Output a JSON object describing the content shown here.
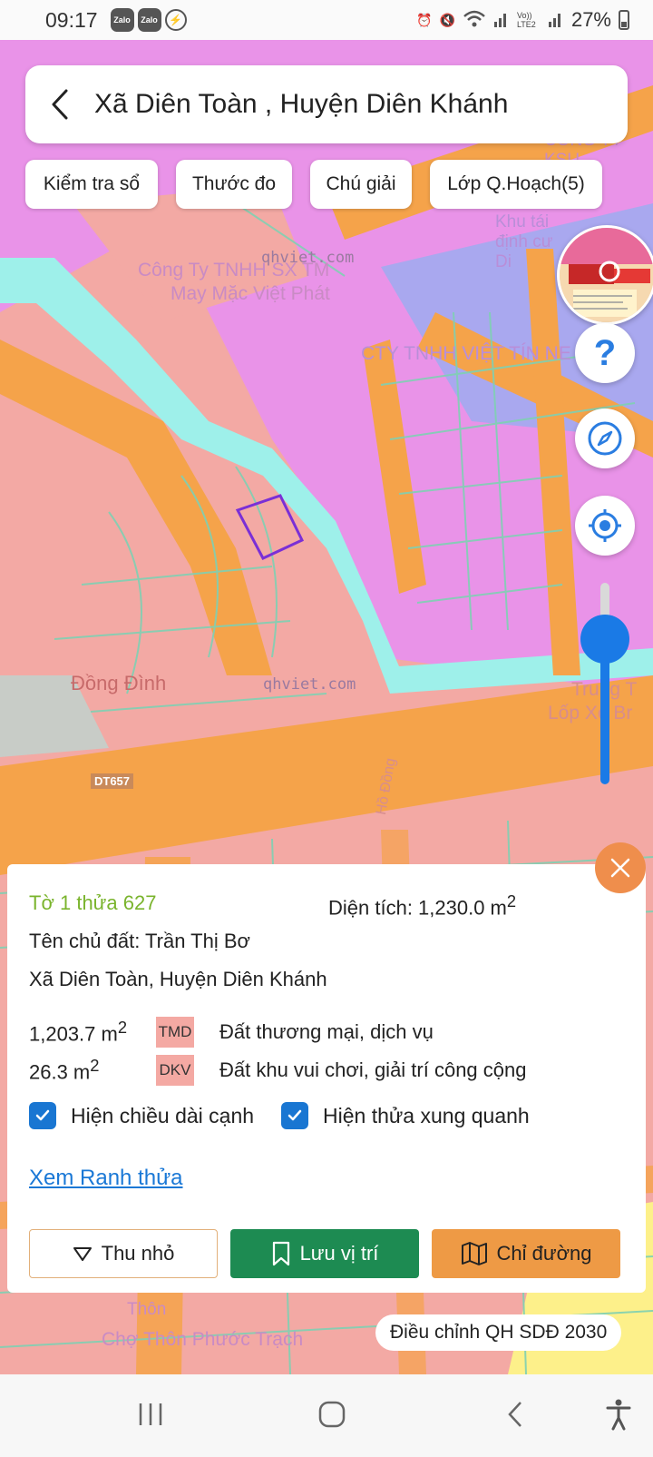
{
  "status_bar": {
    "time": "09:17",
    "apps": [
      "Zalo",
      "Zalo"
    ],
    "network": "Vo)) LTE2",
    "battery": "27%"
  },
  "header": {
    "title": "Xã Diên Toàn , Huyện Diên Khánh"
  },
  "chips": [
    "Kiểm tra sổ",
    "Thước đo",
    "Chú giải",
    "Lớp Q.Hoạch(5)"
  ],
  "map": {
    "labels": {
      "company_1": "Công Ty TNHH SX TM",
      "company_2": "May Mặc Việt Phát",
      "company_3": "CTY TNHH VIỆT TÍN NE",
      "residential": "Khu tái định cư Di",
      "corner": "CÔNG TY KSU",
      "dong_dinh": "Đồng Đình",
      "watermark_1": "qhviet.com",
      "watermark_2": "qhviet.com",
      "road": "DT657",
      "trung_1": "Trung T",
      "trung_2": "Lốp Xe Br",
      "small_road": "Hồ Đồng",
      "cho": "Chợ Thôn Phước Trạch",
      "thon": "Thôn"
    },
    "colors": {
      "residential": "#e993e8",
      "commercial": "#f3a9a4",
      "road": "#f5a34a",
      "water": "#9ef0ea",
      "boundary": "#7fd0b3",
      "selected_parcel": "#7a2fd6",
      "blue_zone": "#a9a8ef"
    }
  },
  "controls": {
    "zoom_level": 0.73
  },
  "panel": {
    "parcel": "Tờ 1 thửa 627",
    "area_label": "Diện tích: 1,230.0 m",
    "area_sup": "2",
    "owner": "Tên chủ đất: Trần Thị Bơ",
    "address": "Xã Diên Toàn, Huyện Diên Khánh",
    "uses": [
      {
        "area": "1,203.7 m",
        "sup": "2",
        "code": "TMD",
        "name": "Đất thương mại, dịch vụ"
      },
      {
        "area": "26.3 m",
        "sup": "2",
        "code": "DKV",
        "name": "Đất khu vui chơi, giải trí công cộng"
      }
    ],
    "checkbox_1": "Hiện chiều dài cạnh",
    "checkbox_2": "Hiện thửa xung quanh",
    "link": "Xem Ranh thửa",
    "btn_shrink": "Thu nhỏ",
    "btn_save": "Lưu vị trí",
    "btn_directions": "Chỉ đường"
  },
  "layer_badge": "Điều chỉnh QH SDĐ 2030"
}
